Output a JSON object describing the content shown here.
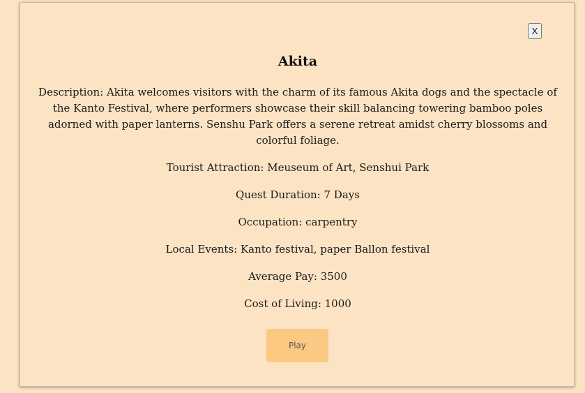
{
  "modal": {
    "close_label": "X",
    "title": "Akita",
    "description": "Description: Akita welcomes visitors with the charm of its famous Akita dogs and the spectacle of the Kanto Festival, where performers showcase their skill balancing towering bamboo poles adorned with paper lanterns. Senshu Park offers a serene retreat amidst cherry blossoms and colorful foliage.",
    "tourist_attraction": "Tourist Attraction: Meuseum of Art, Senshui Park",
    "quest_duration": "Quest Duration: 7 Days",
    "occupation": "Occupation: carpentry",
    "local_events": "Local Events: Kanto festival, paper Ballon festival",
    "average_pay": "Average Pay: 3500",
    "cost_of_living": "Cost of Living: 1000",
    "play_label": "Play"
  },
  "colors": {
    "background": "#fbe3c4",
    "play_button": "#fcc982"
  }
}
